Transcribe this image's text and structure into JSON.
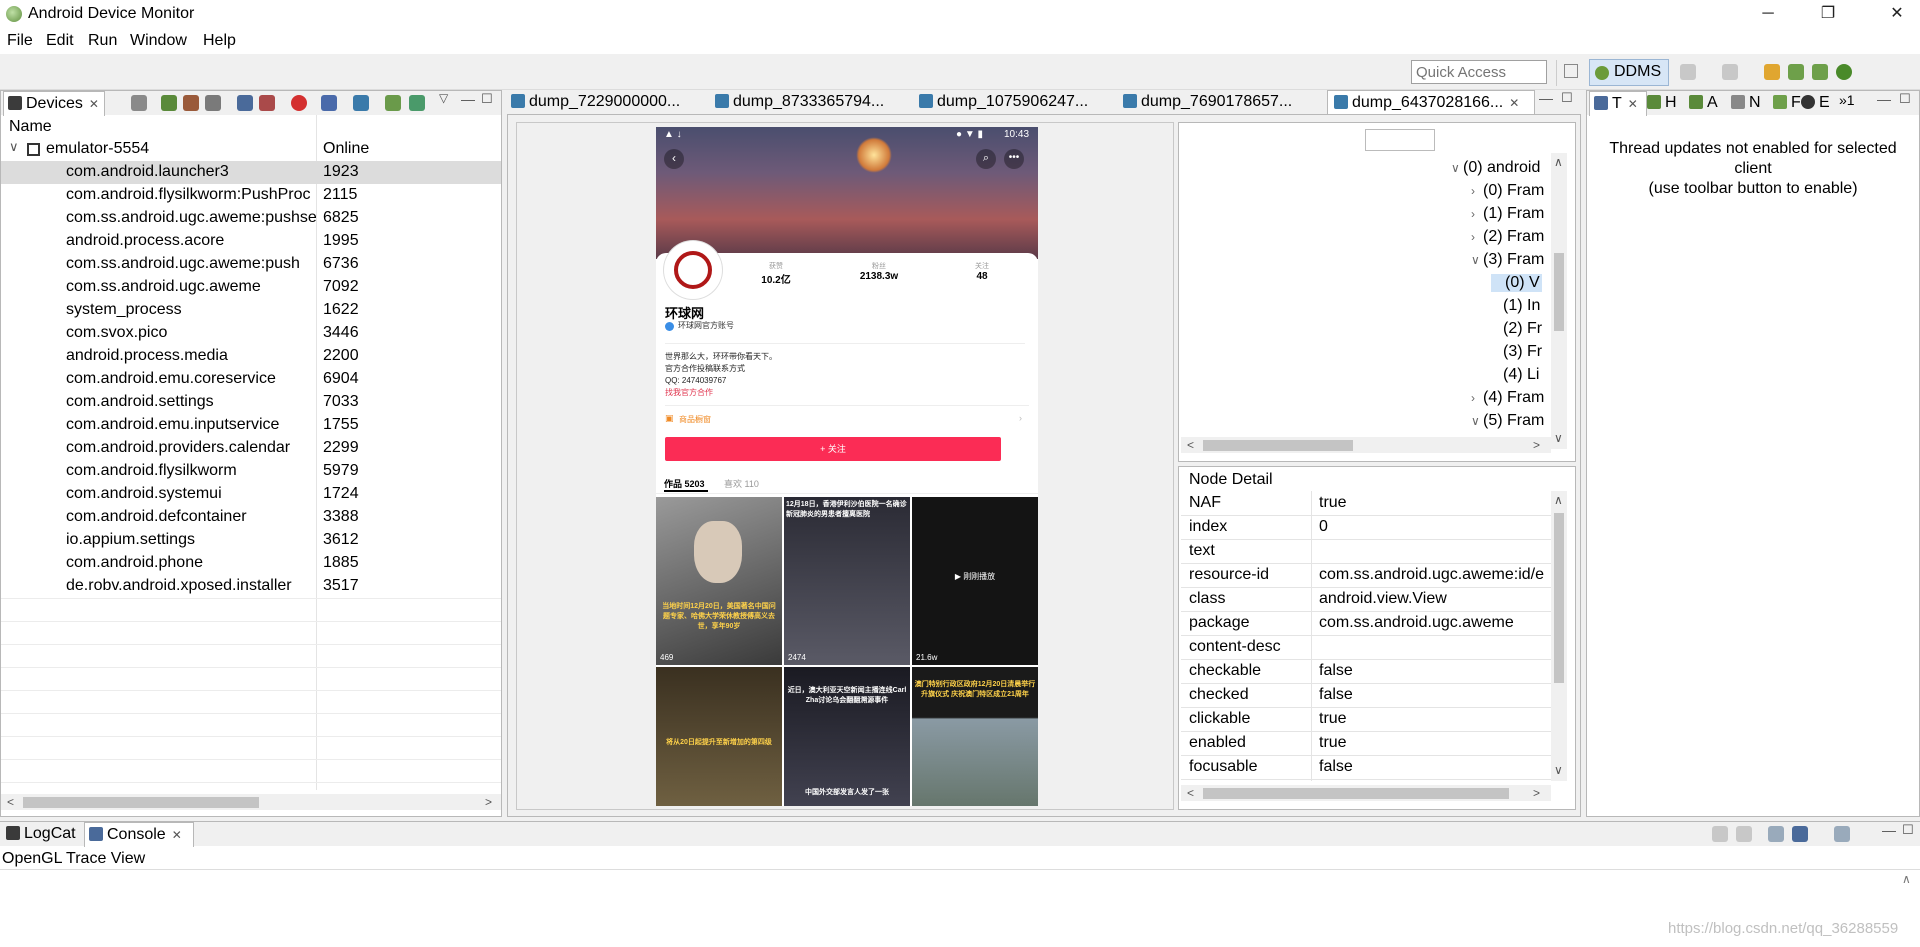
{
  "window": {
    "title": "Android Device Monitor",
    "buttons": {
      "minimize": "─",
      "restore": "❐",
      "close": "✕"
    }
  },
  "menu": [
    "File",
    "Edit",
    "Run",
    "Window",
    "Help"
  ],
  "toolbar": {
    "quick_access_placeholder": "Quick Access",
    "perspective": "DDMS"
  },
  "devices_panel": {
    "tab_label": "Devices",
    "columns": [
      "Name",
      ""
    ],
    "device": {
      "name": "emulator-5554",
      "status": "Online"
    },
    "processes": [
      {
        "name": "com.android.launcher3",
        "pid": "1923"
      },
      {
        "name": "com.android.flysilkworm:PushProc",
        "pid": "2115"
      },
      {
        "name": "com.ss.android.ugc.aweme:pushse",
        "pid": "6825"
      },
      {
        "name": "android.process.acore",
        "pid": "1995"
      },
      {
        "name": "com.ss.android.ugc.aweme:push",
        "pid": "6736"
      },
      {
        "name": "com.ss.android.ugc.aweme",
        "pid": "7092"
      },
      {
        "name": "system_process",
        "pid": "1622"
      },
      {
        "name": "com.svox.pico",
        "pid": "3446"
      },
      {
        "name": "android.process.media",
        "pid": "2200"
      },
      {
        "name": "com.android.emu.coreservice",
        "pid": "6904"
      },
      {
        "name": "com.android.settings",
        "pid": "7033"
      },
      {
        "name": "com.android.emu.inputservice",
        "pid": "1755"
      },
      {
        "name": "com.android.providers.calendar",
        "pid": "2299"
      },
      {
        "name": "com.android.flysilkworm",
        "pid": "5979"
      },
      {
        "name": "com.android.systemui",
        "pid": "1724"
      },
      {
        "name": "com.android.defcontainer",
        "pid": "3388"
      },
      {
        "name": "io.appium.settings",
        "pid": "3612"
      },
      {
        "name": "com.android.phone",
        "pid": "1885"
      },
      {
        "name": "de.robv.android.xposed.installer",
        "pid": "3517"
      }
    ]
  },
  "dump_tabs": [
    "dump_7229000000...",
    "dump_8733365794...",
    "dump_1075906247...",
    "dump_7690178657...",
    "dump_6437028166..."
  ],
  "phone": {
    "status_time": "10:43",
    "stats": [
      {
        "label": "获赞",
        "value": "10.2亿"
      },
      {
        "label": "粉丝",
        "value": "2138.3w"
      },
      {
        "label": "关注",
        "value": "48"
      }
    ],
    "account_name": "环球网",
    "verified_text": "环球网官方账号",
    "bio": [
      "世界那么大，环环带你看天下。",
      "官方合作投稿联系方式",
      "QQ: 2474039767"
    ],
    "bio_link": "找我官方合作",
    "shop_label": "商品橱窗",
    "follow_button": "+ 关注",
    "tab_works": "作品 5203",
    "tab_likes": "喜欢 110",
    "thumbs": [
      {
        "caption": "当地时间12月20日，美国著名中国问题专家、哈佛大学荣休教授傅高义去世，享年90岁",
        "count": "469"
      },
      {
        "caption": "12月18日，香港伊利沙伯医院一名确诊新冠肺炎的男患者擅离医院",
        "count": "2474"
      },
      {
        "caption": "▶ 刚刚播放",
        "count": "21.6w"
      },
      {
        "caption": "将从20日起提升至新增加的第四级",
        "count": ""
      },
      {
        "caption": "近日，澳大利亚天空新闻主播连线Carl Zha讨论乌会翻翻溯源事件",
        "count": ""
      },
      {
        "caption": "澳门特别行政区政府12月20日清晨举行升旗仪式 庆祝澳门特区成立21周年",
        "count": ""
      }
    ],
    "thumb_bottom_caption": "中国外交部发言人发了一张"
  },
  "hierarchy": {
    "items": [
      {
        "label": "(0) android",
        "chev": "down",
        "indent": 0
      },
      {
        "label": "(0) Fram",
        "chev": "right",
        "indent": 1
      },
      {
        "label": "(1) Fram",
        "chev": "right",
        "indent": 1
      },
      {
        "label": "(2) Fram",
        "chev": "right",
        "indent": 1
      },
      {
        "label": "(3) Fram",
        "chev": "down",
        "indent": 1
      },
      {
        "label": "(0) V",
        "chev": "",
        "indent": 2,
        "selected": true
      },
      {
        "label": "(1) In",
        "chev": "",
        "indent": 2
      },
      {
        "label": "(2) Fr",
        "chev": "",
        "indent": 2
      },
      {
        "label": "(3) Fr",
        "chev": "",
        "indent": 2
      },
      {
        "label": "(4) Li",
        "chev": "",
        "indent": 2
      },
      {
        "label": "(4) Fram",
        "chev": "right",
        "indent": 1
      },
      {
        "label": "(5) Fram",
        "chev": "down",
        "indent": 1
      }
    ]
  },
  "node_detail": {
    "title": "Node Detail",
    "rows": [
      {
        "key": "NAF",
        "value": "true"
      },
      {
        "key": "index",
        "value": "0"
      },
      {
        "key": "text",
        "value": ""
      },
      {
        "key": "resource-id",
        "value": "com.ss.android.ugc.aweme:id/e"
      },
      {
        "key": "class",
        "value": "android.view.View"
      },
      {
        "key": "package",
        "value": "com.ss.android.ugc.aweme"
      },
      {
        "key": "content-desc",
        "value": ""
      },
      {
        "key": "checkable",
        "value": "false"
      },
      {
        "key": "checked",
        "value": "false"
      },
      {
        "key": "clickable",
        "value": "true"
      },
      {
        "key": "enabled",
        "value": "true"
      },
      {
        "key": "focusable",
        "value": "false"
      }
    ]
  },
  "threads_panel": {
    "tabs": [
      "T",
      "H",
      "A",
      "N",
      "F",
      "E"
    ],
    "overflow": "»1",
    "message_line1": "Thread updates not enabled for selected",
    "message_line2": "client",
    "message_line3": "(use toolbar button to enable)"
  },
  "bottom_panel": {
    "tabs": [
      "LogCat",
      "Console"
    ],
    "content_title": "OpenGL Trace View"
  },
  "watermark": "https://blog.csdn.net/qq_36288559"
}
